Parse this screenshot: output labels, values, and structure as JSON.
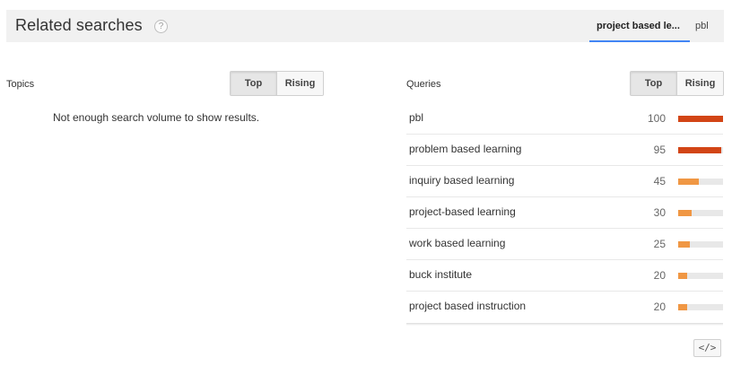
{
  "header": {
    "title": "Related searches",
    "help_icon": "question-icon",
    "tabs": [
      {
        "label": "project based le...",
        "active": true
      },
      {
        "label": "pbl",
        "active": false
      }
    ]
  },
  "topics": {
    "label": "Topics",
    "toggle": {
      "top": "Top",
      "rising": "Rising",
      "selected": "Top"
    },
    "empty_message": "Not enough search volume to show results."
  },
  "queries": {
    "label": "Queries",
    "toggle": {
      "top": "Top",
      "rising": "Rising",
      "selected": "Top"
    },
    "colors": {
      "high": "#d24516",
      "medium": "#f09744",
      "track": "#e8e8e8"
    },
    "items": [
      {
        "query": "pbl",
        "value": "100"
      },
      {
        "query": "problem based learning",
        "value": "95"
      },
      {
        "query": "inquiry based learning",
        "value": "45"
      },
      {
        "query": "project-based learning",
        "value": "30"
      },
      {
        "query": "work based learning",
        "value": "25"
      },
      {
        "query": "buck institute",
        "value": "20"
      },
      {
        "query": "project based instruction",
        "value": "20"
      }
    ]
  },
  "embed_button": {
    "label": "</>",
    "icon": "embed-code-icon"
  }
}
